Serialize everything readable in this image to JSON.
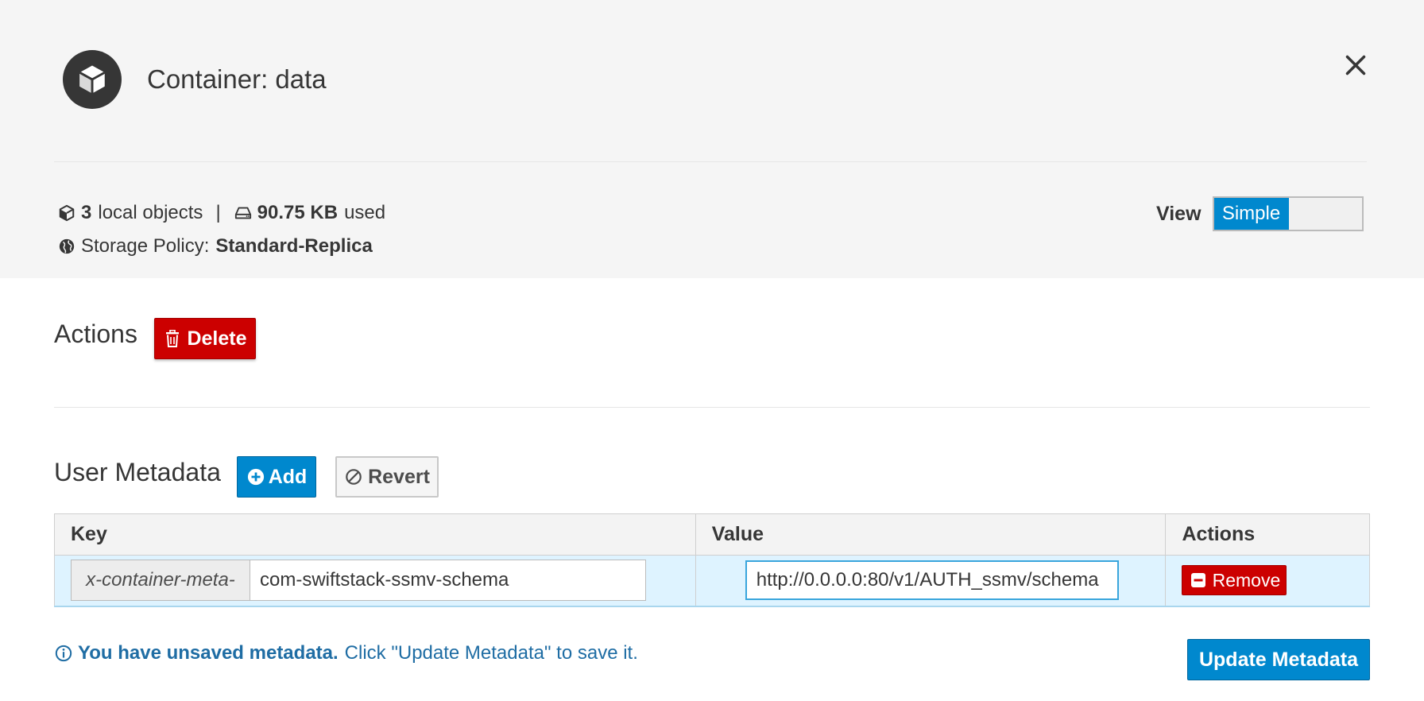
{
  "header": {
    "title": "Container: data",
    "icon": "cube-icon"
  },
  "stats": {
    "objects_count": "3",
    "objects_label": "local objects",
    "separator": "|",
    "used_value": "90.75 KB",
    "used_label": "used",
    "policy_label": "Storage Policy:",
    "policy_value": "Standard-Replica"
  },
  "view": {
    "label": "View",
    "selected": "Simple"
  },
  "actions": {
    "label": "Actions",
    "delete_label": "Delete"
  },
  "user_metadata": {
    "label": "User Metadata",
    "add_label": "Add",
    "revert_label": "Revert",
    "columns": [
      "Key",
      "Value",
      "Actions"
    ],
    "rows": [
      {
        "key_prefix": "x-container-meta-",
        "key": "com-swiftstack-ssmv-schema",
        "value": "http://0.0.0.0:80/v1/AUTH_ssmv/schema",
        "remove_label": "Remove"
      }
    ]
  },
  "notice": {
    "bold": "You have unsaved metadata.",
    "text": "Click \"Update Metadata\" to save it."
  },
  "update_label": "Update Metadata",
  "colors": {
    "primary": "#0088ce",
    "danger": "#cc0000",
    "row_highlight": "#def3ff",
    "notice_text": "#1f6da4"
  }
}
